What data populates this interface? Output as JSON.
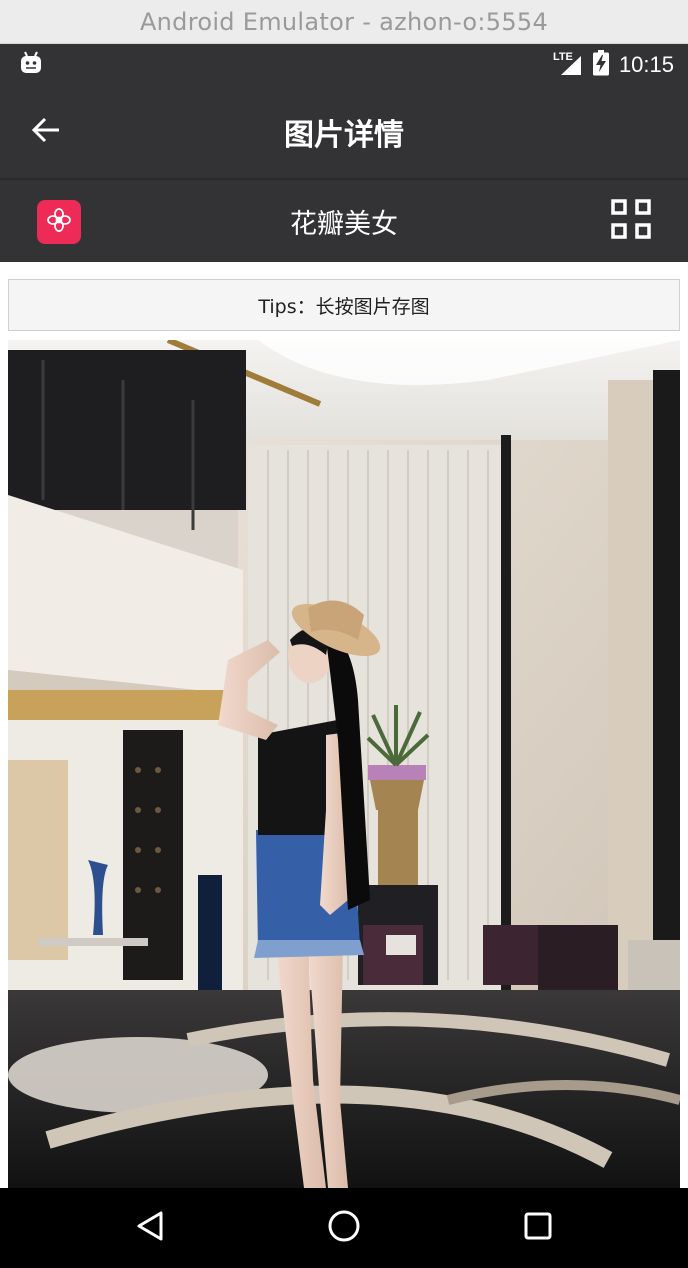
{
  "window": {
    "title": "Android Emulator - azhon-o:5554"
  },
  "status_bar": {
    "time": "10:15",
    "network": "LTE",
    "icons": [
      "android-icon",
      "lte-signal-icon",
      "battery-charging-icon"
    ]
  },
  "app_bar": {
    "title": "图片详情",
    "back_icon": "arrow-left-icon"
  },
  "sub_header": {
    "title": "花瓣美女",
    "logo_icon": "flower-logo-icon",
    "grid_icon": "grid-icon",
    "accent": "#ee2a57"
  },
  "tips": {
    "text": "Tips：长按图片存图"
  },
  "photo": {
    "description_icon": "photo"
  },
  "nav_bar": {
    "icons": [
      "back-triangle-icon",
      "home-circle-icon",
      "recents-square-icon"
    ]
  },
  "colors": {
    "toolbar": "#333336",
    "background": "#ffffff",
    "tips_bg": "#f5f5f5"
  }
}
